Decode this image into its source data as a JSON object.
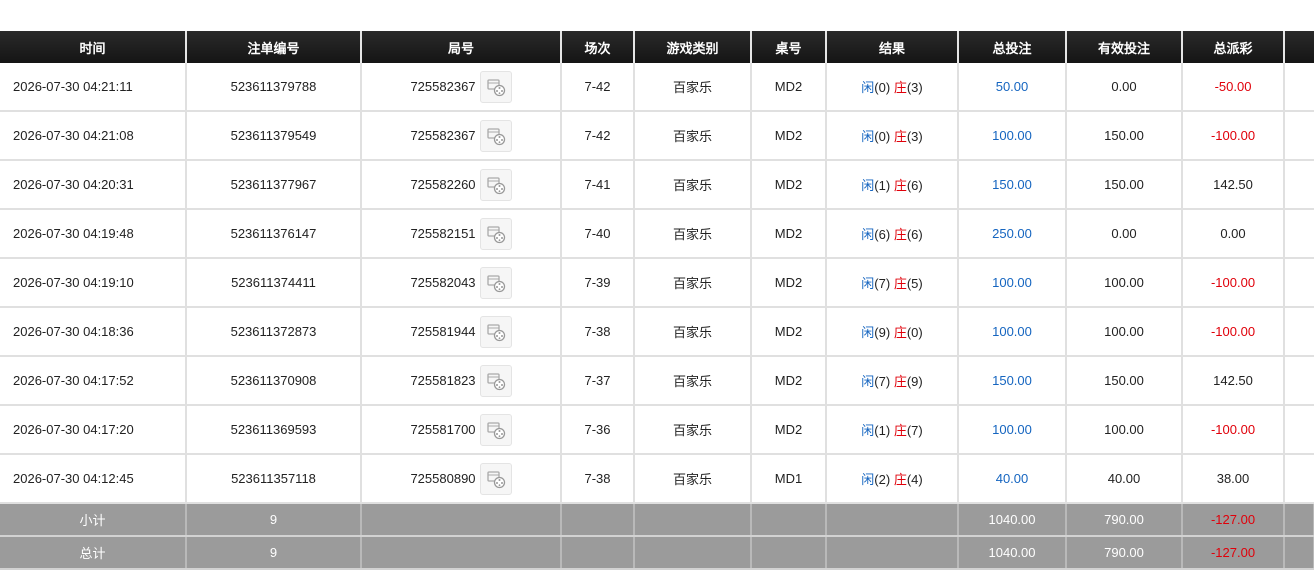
{
  "headers": [
    "时间",
    "注单编号",
    "局号",
    "场次",
    "游戏类别",
    "桌号",
    "结果",
    "总投注",
    "有效投注",
    "总派彩"
  ],
  "player_char": "闲",
  "banker_char": "庄",
  "rows": [
    {
      "time": "2026-07-30 04:21:11",
      "bet_id": "523611379788",
      "round": "725582367",
      "session": "7-42",
      "game": "百家乐",
      "table": "MD2",
      "p": "(0)",
      "b": "(3)",
      "total": "50.00",
      "valid": "0.00",
      "payout": "-50.00",
      "payout_color": "red"
    },
    {
      "time": "2026-07-30 04:21:08",
      "bet_id": "523611379549",
      "round": "725582367",
      "session": "7-42",
      "game": "百家乐",
      "table": "MD2",
      "p": "(0)",
      "b": "(3)",
      "total": "100.00",
      "valid": "150.00",
      "payout": "-100.00",
      "payout_color": "red"
    },
    {
      "time": "2026-07-30 04:20:31",
      "bet_id": "523611377967",
      "round": "725582260",
      "session": "7-41",
      "game": "百家乐",
      "table": "MD2",
      "p": "(1)",
      "b": "(6)",
      "total": "150.00",
      "valid": "150.00",
      "payout": "142.50",
      "payout_color": "black"
    },
    {
      "time": "2026-07-30 04:19:48",
      "bet_id": "523611376147",
      "round": "725582151",
      "session": "7-40",
      "game": "百家乐",
      "table": "MD2",
      "p": "(6)",
      "b": "(6)",
      "total": "250.00",
      "valid": "0.00",
      "payout": "0.00",
      "payout_color": "black"
    },
    {
      "time": "2026-07-30 04:19:10",
      "bet_id": "523611374411",
      "round": "725582043",
      "session": "7-39",
      "game": "百家乐",
      "table": "MD2",
      "p": "(7)",
      "b": "(5)",
      "total": "100.00",
      "valid": "100.00",
      "payout": "-100.00",
      "payout_color": "red"
    },
    {
      "time": "2026-07-30 04:18:36",
      "bet_id": "523611372873",
      "round": "725581944",
      "session": "7-38",
      "game": "百家乐",
      "table": "MD2",
      "p": "(9)",
      "b": "(0)",
      "total": "100.00",
      "valid": "100.00",
      "payout": "-100.00",
      "payout_color": "red"
    },
    {
      "time": "2026-07-30 04:17:52",
      "bet_id": "523611370908",
      "round": "725581823",
      "session": "7-37",
      "game": "百家乐",
      "table": "MD2",
      "p": "(7)",
      "b": "(9)",
      "total": "150.00",
      "valid": "150.00",
      "payout": "142.50",
      "payout_color": "black"
    },
    {
      "time": "2026-07-30 04:17:20",
      "bet_id": "523611369593",
      "round": "725581700",
      "session": "7-36",
      "game": "百家乐",
      "table": "MD2",
      "p": "(1)",
      "b": "(7)",
      "total": "100.00",
      "valid": "100.00",
      "payout": "-100.00",
      "payout_color": "red"
    },
    {
      "time": "2026-07-30 04:12:45",
      "bet_id": "523611357118",
      "round": "725580890",
      "session": "7-38",
      "game": "百家乐",
      "table": "MD1",
      "p": "(2)",
      "b": "(4)",
      "total": "40.00",
      "valid": "40.00",
      "payout": "38.00",
      "payout_color": "black"
    }
  ],
  "subtotal": {
    "label": "小计",
    "count": "9",
    "total": "1040.00",
    "valid": "790.00",
    "payout": "-127.00"
  },
  "grandtotal": {
    "label": "总计",
    "count": "9",
    "total": "1040.00",
    "valid": "790.00",
    "payout": "-127.00"
  },
  "colors": {
    "header_bg": "#1a1a1a",
    "sum_bg": "#9b9b9b",
    "blue": "#1565c0",
    "red": "#e0000a"
  },
  "icons": {
    "video": "video-replay-icon"
  }
}
